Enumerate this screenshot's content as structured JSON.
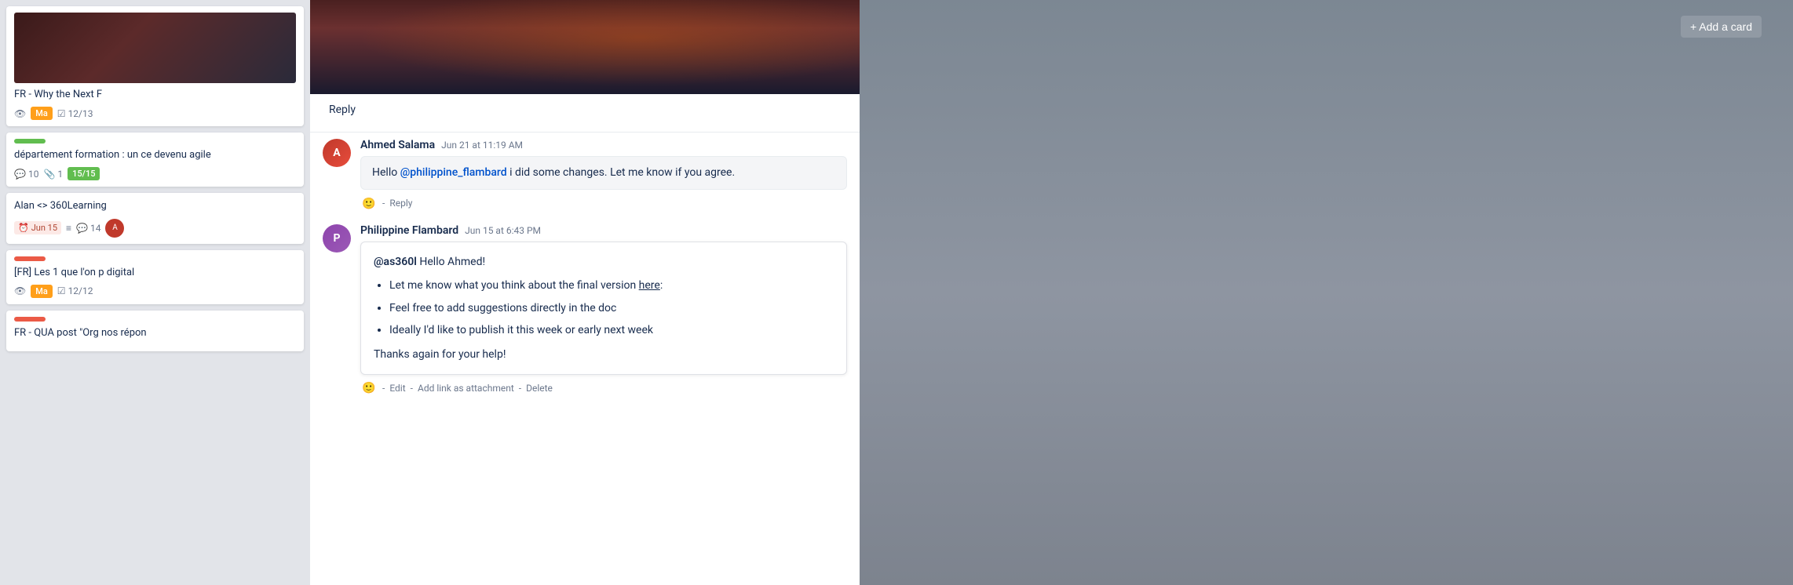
{
  "sidebar": {
    "cards": [
      {
        "id": "card1",
        "hasImage": true,
        "imageType": "dark",
        "label": null,
        "title": "FR - Why the Next F",
        "meta": [
          {
            "type": "eye"
          },
          {
            "type": "badge-orange",
            "text": "Ma"
          },
          {
            "type": "check",
            "text": "12/13"
          }
        ]
      },
      {
        "id": "card2",
        "hasImage": false,
        "label": {
          "color": "#61bd4f"
        },
        "title": "département formation : un ce devenu agile",
        "meta": [
          {
            "type": "comment",
            "text": "10"
          },
          {
            "type": "clip",
            "text": "1"
          },
          {
            "type": "badge-green",
            "text": "15/15"
          }
        ]
      },
      {
        "id": "card3",
        "hasImage": false,
        "label": null,
        "title": "Alan <> 360Learning",
        "meta": [
          {
            "type": "date",
            "text": "Jun 15"
          },
          {
            "type": "lines"
          },
          {
            "type": "comment",
            "text": "14"
          }
        ],
        "hasAvatar": true
      },
      {
        "id": "card4",
        "hasImage": false,
        "label": {
          "color": "#eb5a46"
        },
        "title": "[FR] Les 1 que l'on p digital",
        "meta": [
          {
            "type": "eye"
          },
          {
            "type": "badge-orange",
            "text": "Ma"
          },
          {
            "type": "check",
            "text": "12/12"
          }
        ]
      },
      {
        "id": "card5",
        "hasImage": false,
        "label": {
          "color": "#eb5a46"
        },
        "title": "FR - QUA post \"Org nos répon",
        "meta": []
      }
    ]
  },
  "hero": {
    "alt": "Hero image"
  },
  "comments": [
    {
      "id": "comment-ahmed",
      "author": "Ahmed Salama",
      "time": "Jun 21 at 11:19 AM",
      "avatarInitial": "A",
      "message_pre": "Hello ",
      "mention": "@philippine_flambard",
      "message_post": " i did some changes. Let me know if you agree.",
      "actions": [
        {
          "type": "emoji"
        },
        {
          "type": "sep",
          "text": "-"
        },
        {
          "type": "link",
          "text": "Reply",
          "id": "reply-ahmed"
        }
      ]
    },
    {
      "id": "comment-philippine",
      "author": "Philippine Flambard",
      "time": "Jun 15 at 6:43 PM",
      "avatarInitial": "P",
      "mention_header": "@as360l",
      "greeting": " Hello Ahmed!",
      "bullet1": "Let me know what you think about the final version ",
      "bullet1_link": "here",
      "bullet1_post": ":",
      "bullet2": "Feel free to add suggestions directly in the doc",
      "bullet3": "Ideally I'd like to publish it this week or early next week",
      "thanks": "Thanks again for your help!",
      "actions": [
        {
          "type": "emoji"
        },
        {
          "type": "sep",
          "text": "-"
        },
        {
          "type": "link",
          "text": "Edit",
          "id": "edit-link"
        },
        {
          "type": "sep",
          "text": "-"
        },
        {
          "type": "link",
          "text": "Add link as attachment",
          "id": "add-link"
        },
        {
          "type": "sep",
          "text": "-"
        },
        {
          "type": "link",
          "text": "Delete",
          "id": "delete-link"
        }
      ]
    }
  ],
  "topReply": {
    "label": "Reply"
  },
  "addCard": {
    "label": "+ Add a card"
  }
}
